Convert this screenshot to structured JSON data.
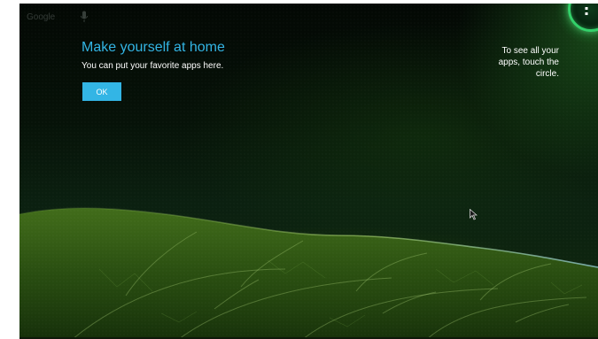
{
  "search": {
    "label": "Google",
    "mic_icon": "mic-icon"
  },
  "cling": {
    "title": "Make yourself at home",
    "body": "You can put your favorite apps here.",
    "ok_label": "OK"
  },
  "apps_hint": {
    "line1": "To see all your",
    "line2": "apps, touch the",
    "line3": "circle."
  },
  "icons": {
    "all_apps": "all-apps-icon",
    "cursor": "mouse-cursor-icon"
  },
  "colors": {
    "accent": "#33b5e5",
    "circle_ring": "#33d06a"
  }
}
